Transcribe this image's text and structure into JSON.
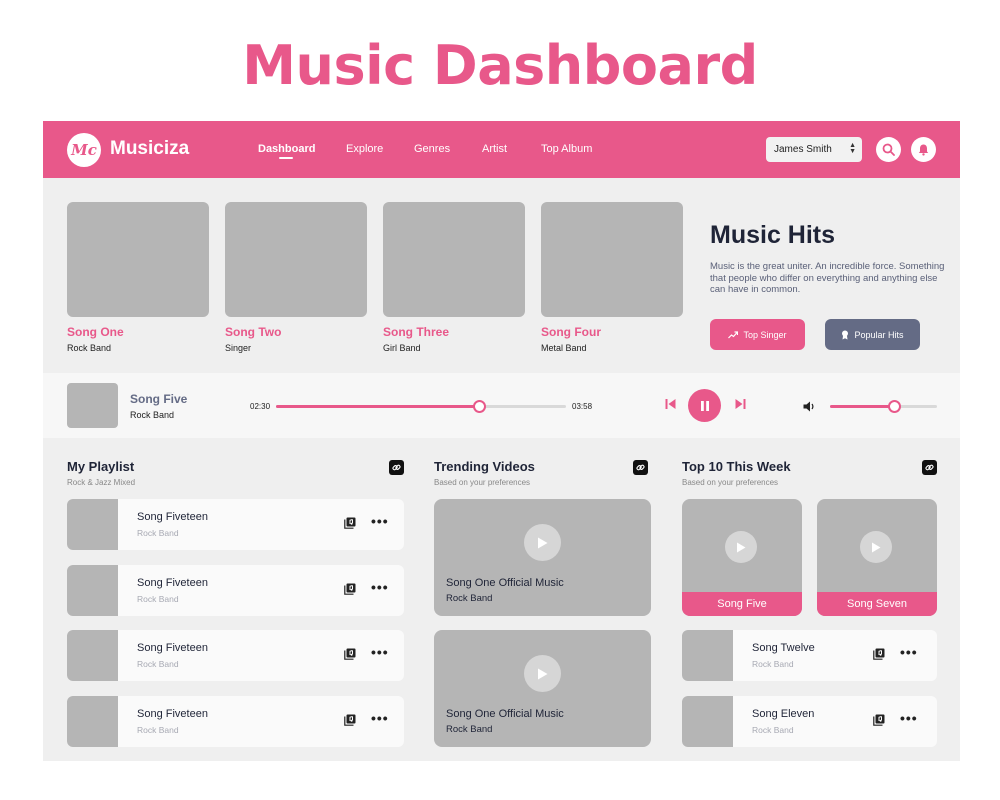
{
  "page_title": "Music Dashboard",
  "header": {
    "logo": "Mc",
    "brand": "Musiciza",
    "nav": [
      {
        "label": "Dashboard",
        "active": true
      },
      {
        "label": "Explore"
      },
      {
        "label": "Genres"
      },
      {
        "label": "Artist"
      },
      {
        "label": "Top Album"
      }
    ],
    "user": "James Smith",
    "icons": [
      "search-icon",
      "bell-icon"
    ]
  },
  "hero": {
    "cards": [
      {
        "title": "Song One",
        "artist": "Rock Band"
      },
      {
        "title": "Song Two",
        "artist": "Singer"
      },
      {
        "title": "Song Three",
        "artist": "Girl Band"
      },
      {
        "title": "Song Four",
        "artist": "Metal Band"
      }
    ],
    "hits_title": "Music Hits",
    "hits_desc": "Music is the great uniter. An incredible force. Something that people who differ on everything and anything else can have in common.",
    "buttons": {
      "top_singer": "Top Singer",
      "popular_hits": "Popular Hits"
    }
  },
  "player": {
    "title": "Song Five",
    "artist": "Rock Band",
    "elapsed": "02:30",
    "duration": "03:58",
    "progress": 0.7,
    "volume": 0.6
  },
  "playlist": {
    "title": "My Playlist",
    "subtitle": "Rock & Jazz Mixed",
    "items": [
      {
        "title": "Song Fiveteen",
        "artist": "Rock Band"
      },
      {
        "title": "Song Fiveteen",
        "artist": "Rock Band"
      },
      {
        "title": "Song Fiveteen",
        "artist": "Rock Band"
      },
      {
        "title": "Song Fiveteen",
        "artist": "Rock Band"
      }
    ]
  },
  "trending": {
    "title": "Trending Videos",
    "subtitle": "Based on your preferences",
    "videos": [
      {
        "title": "Song One Official Music",
        "artist": "Rock Band"
      },
      {
        "title": "Song One Official Music",
        "artist": "Rock Band"
      }
    ]
  },
  "top10": {
    "title": "Top 10 This Week",
    "subtitle": "Based on your preferences",
    "cards": [
      {
        "title": "Song Five"
      },
      {
        "title": "Song Seven"
      }
    ],
    "items": [
      {
        "title": "Song Twelve",
        "artist": "Rock Band"
      },
      {
        "title": "Song Eleven",
        "artist": "Rock Band"
      }
    ]
  },
  "colors": {
    "accent": "#e8588a",
    "slate": "#646b85",
    "placeholder": "#b5b5b5"
  }
}
